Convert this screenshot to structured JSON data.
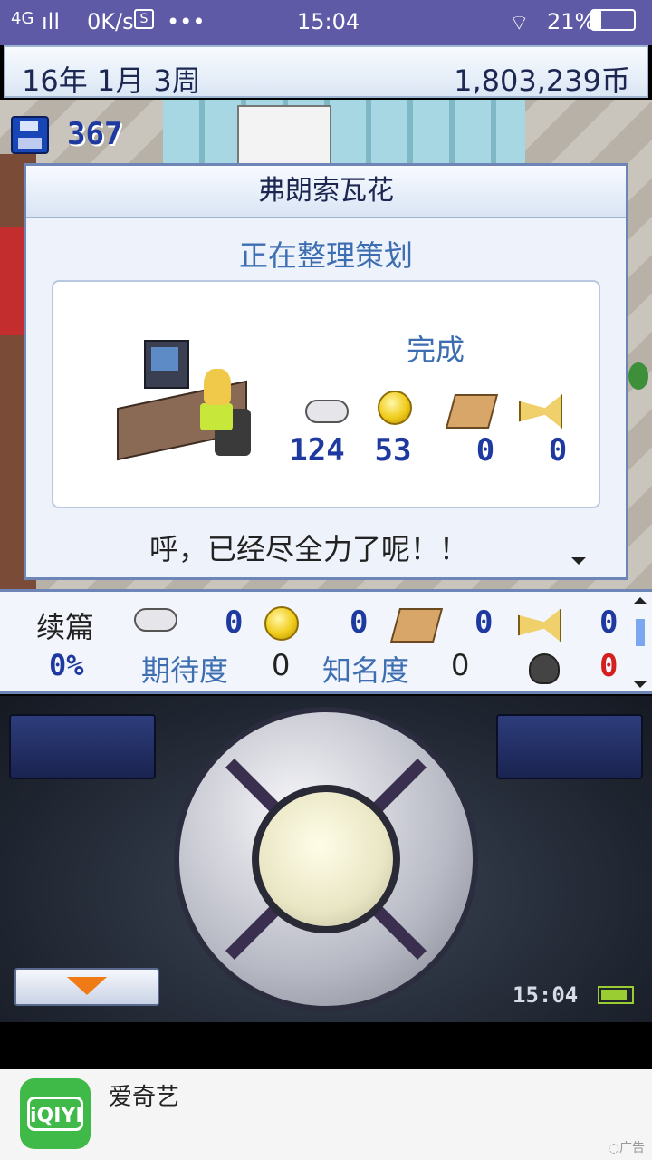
{
  "status_bar": {
    "network": "4G",
    "signal": "ıll",
    "speed": "0K/s",
    "s_badge": "S",
    "more": "•••",
    "time": "15:04",
    "wifi": "⌔",
    "battery": "21%"
  },
  "header": {
    "date": "16年 1月 3周",
    "money": "1,803,239币"
  },
  "save": {
    "count": "367"
  },
  "dialog": {
    "title": "弗朗索瓦花",
    "subtitle": "正在整理策划",
    "done_label": "完成",
    "stats": [
      {
        "icon": "gamepad-icon",
        "value": "124"
      },
      {
        "icon": "coin-icon",
        "value": "53"
      },
      {
        "icon": "brush-icon",
        "value": "0"
      },
      {
        "icon": "horn-icon",
        "value": "0"
      }
    ],
    "message": "呼，已经尽全力了呢！！"
  },
  "panel": {
    "sequel_label": "续篇",
    "values": [
      "0",
      "0",
      "0",
      "0"
    ],
    "percent": "0%",
    "expect_label": "期待度",
    "expect_value": "0",
    "fame_label": "知名度",
    "fame_value": "0",
    "bug_value": "0"
  },
  "controller": {
    "clock": "15:04"
  },
  "ad": {
    "logo_text": "iQIYI",
    "name": "爱奇艺",
    "tag": "◌广告"
  },
  "colors": {
    "status_bar": "#5f5aa6",
    "accent_blue": "#3c6eb1",
    "number_blue": "#1e3aa0",
    "bug_red": "#d51f1f"
  }
}
